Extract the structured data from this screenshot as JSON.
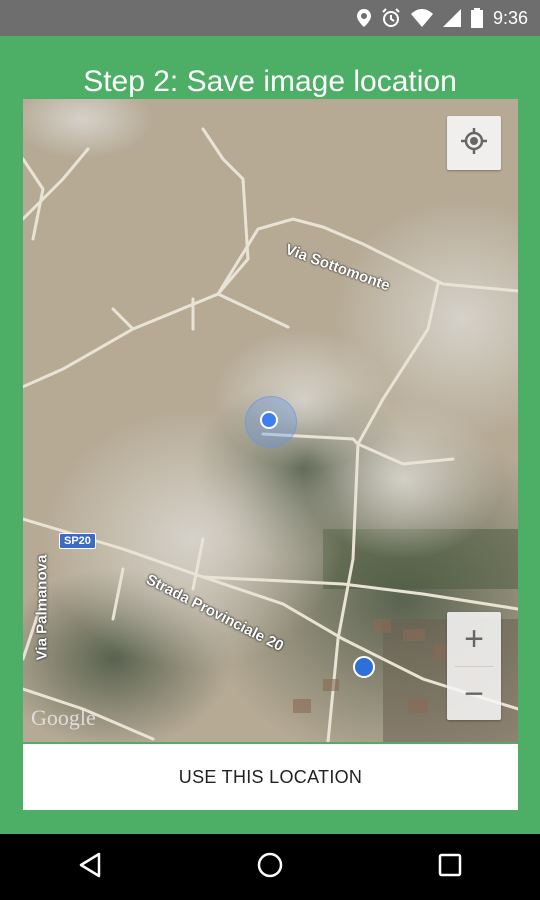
{
  "status_bar": {
    "time": "9:36",
    "icons": [
      "location-icon",
      "alarm-icon",
      "wifi-icon",
      "signal-icon",
      "battery-icon"
    ]
  },
  "screen": {
    "title": "Step 2: Save image location"
  },
  "map": {
    "roads": [
      "Via Sottomonte",
      "Strada Provinciale 20",
      "Via Palmanova"
    ],
    "route_badge": "SP20",
    "logo": "Google"
  },
  "actions": {
    "use_location_label": "USE THIS LOCATION",
    "zoom_in": "+",
    "zoom_out": "−"
  },
  "nav_bar": {
    "icons": [
      "back-icon",
      "home-icon",
      "recents-icon"
    ]
  },
  "colors": {
    "app_bg": "#4caf65",
    "status_bar": "#6e6e6e",
    "pin": "#3d7ff0"
  }
}
